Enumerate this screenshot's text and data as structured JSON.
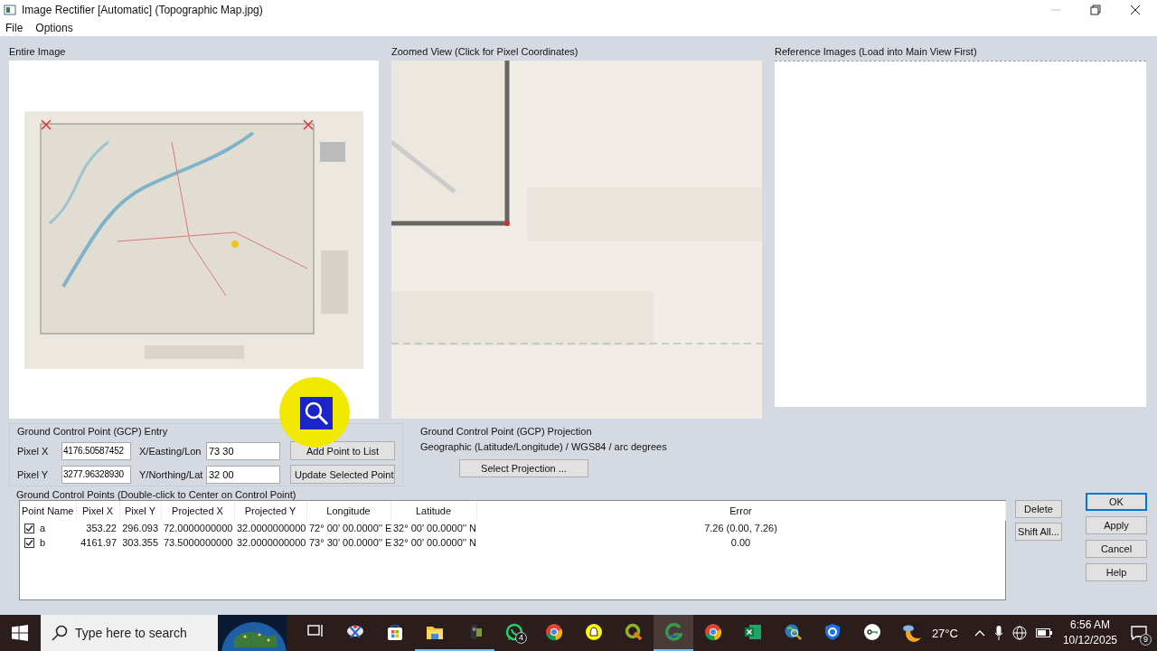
{
  "window": {
    "title": "Image Rectifier [Automatic] (Topographic Map.jpg)"
  },
  "menu": [
    "File",
    "Options"
  ],
  "panels": [
    {
      "kind": "entire",
      "label": "Entire Image"
    },
    {
      "kind": "zoomed",
      "label": "Zoomed View (Click for Pixel Coordinates)"
    },
    {
      "kind": "reference",
      "label": "Reference Images (Load into Main View First)"
    }
  ],
  "gcp_entry": {
    "title": "Ground Control Point (GCP) Entry",
    "rows": [
      {
        "pixel_label": "Pixel X",
        "pixel_value": "4176.50587452",
        "coord_label": "X/Easting/Lon",
        "coord_value": "73 30",
        "button": "Add Point to List"
      },
      {
        "pixel_label": "Pixel Y",
        "pixel_value": "3277.96328930",
        "coord_label": "Y/Northing/Lat",
        "coord_value": "32 00",
        "button": "Update Selected Point"
      }
    ]
  },
  "projection": {
    "title": "Ground Control Point (GCP) Projection",
    "text": "Geographic (Latitude/Longitude) / WGS84 / arc degrees",
    "button": "Select Projection ..."
  },
  "gcp_list": {
    "title": "Ground Control Points (Double-click to Center on Control Point)",
    "columns": [
      "Point Name",
      "Pixel X",
      "Pixel Y",
      "Projected X",
      "Projected Y",
      "Longitude",
      "Latitude",
      "Error"
    ],
    "rows": [
      {
        "checked": true,
        "cells": [
          "a",
          "353.22",
          "296.093",
          "72.0000000000",
          "32.0000000000",
          "72° 00' 00.0000'' E",
          "32° 00' 00.0000'' N",
          "7.26 (0.00, 7.26)"
        ]
      },
      {
        "checked": true,
        "cells": [
          "b",
          "4161.97",
          "303.355",
          "73.5000000000",
          "32.0000000000",
          "73° 30' 00.0000'' E",
          "32° 00' 00.0000'' N",
          "0.00"
        ]
      }
    ]
  },
  "list_buttons": [
    "Delete",
    "Shift All..."
  ],
  "dialog_buttons": [
    {
      "label": "OK",
      "default": true
    },
    {
      "label": "Apply",
      "default": false
    },
    {
      "label": "Cancel",
      "default": false
    },
    {
      "label": "Help",
      "default": false
    }
  ],
  "taskbar": {
    "search_placeholder": "Type here to search",
    "apps": [
      {
        "kind": "taskview",
        "running": false,
        "active": false
      },
      {
        "kind": "snip",
        "running": false,
        "active": false
      },
      {
        "kind": "store",
        "running": false,
        "active": false
      },
      {
        "kind": "folder",
        "running": true,
        "active": false
      },
      {
        "kind": "camera",
        "running": true,
        "active": false
      },
      {
        "kind": "chat",
        "running": false,
        "active": false,
        "badge": "4"
      },
      {
        "kind": "browser",
        "running": false,
        "active": false
      },
      {
        "kind": "ghost",
        "running": false,
        "active": false
      },
      {
        "kind": "qgis",
        "running": false,
        "active": false
      },
      {
        "kind": "swirl",
        "running": true,
        "active": true
      },
      {
        "kind": "browser",
        "running": false,
        "active": false
      },
      {
        "kind": "sheet",
        "running": false,
        "active": false
      },
      {
        "kind": "globe",
        "running": false,
        "active": false
      },
      {
        "kind": "shield",
        "running": false,
        "active": false
      },
      {
        "kind": "key",
        "running": false,
        "active": false
      }
    ],
    "temperature": "27°C",
    "time": "6:56 AM",
    "date": "10/12/2025",
    "notifications": "9"
  }
}
